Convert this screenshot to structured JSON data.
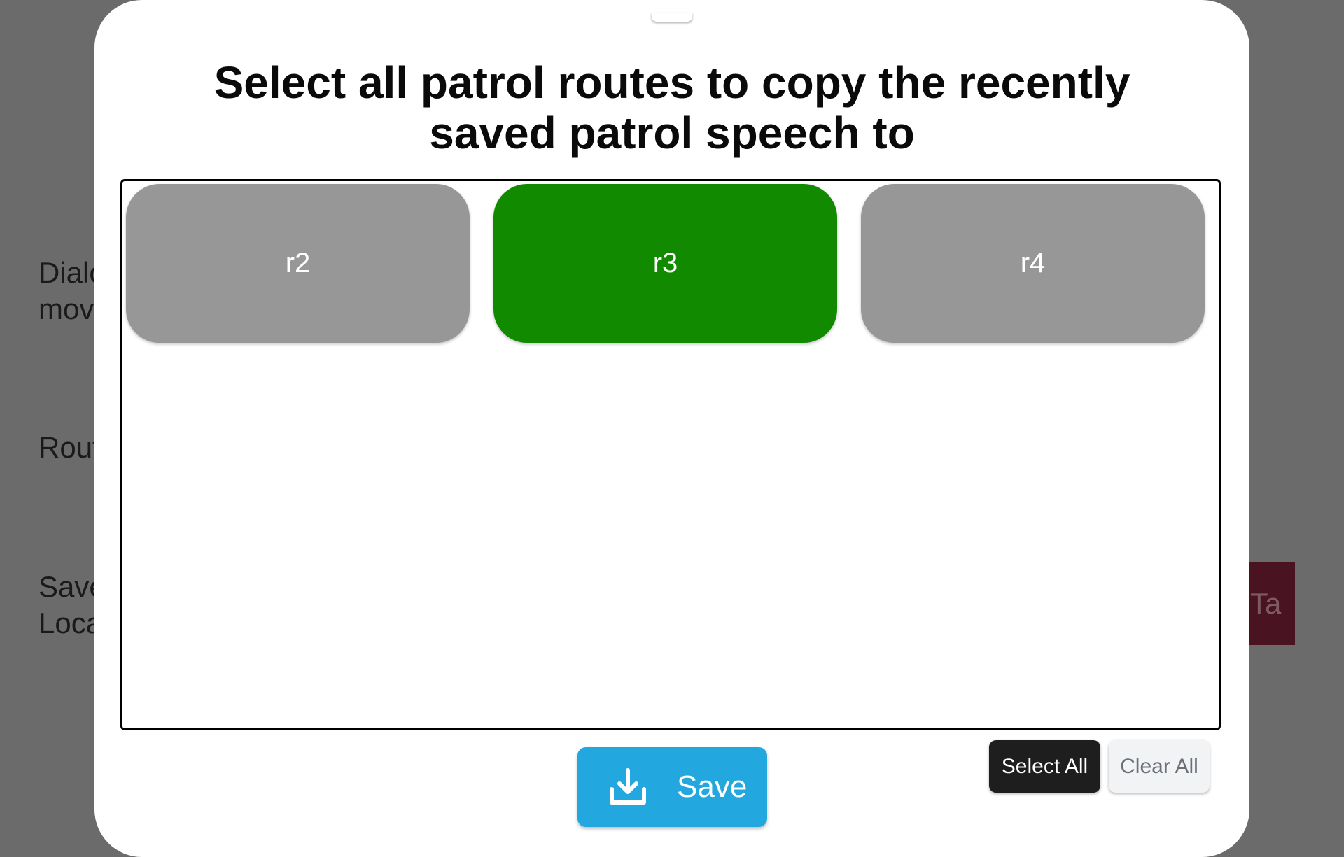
{
  "background": {
    "labels": [
      {
        "line1": "Dialo",
        "line2": "movi"
      },
      {
        "line1": "Rout",
        "line2": ""
      },
      {
        "line1": "Save",
        "line2": "Loca"
      }
    ],
    "right_button_text": "Ta"
  },
  "dialog": {
    "title_line1": "Select all patrol routes to copy the recently",
    "title_line2": "saved patrol speech to",
    "routes": [
      {
        "label": "r2",
        "selected": false
      },
      {
        "label": "r3",
        "selected": true
      },
      {
        "label": "r4",
        "selected": false
      }
    ],
    "save_label": "Save",
    "save_icon": "download-icon",
    "select_all_label": "Select All",
    "clear_all_label": "Clear All"
  },
  "colors": {
    "selected_route": "#128a00",
    "unselected_route": "#979797",
    "save_button": "#22a8df",
    "select_all_button": "#1e1e1e",
    "clear_all_button": "#f1f3f5"
  }
}
